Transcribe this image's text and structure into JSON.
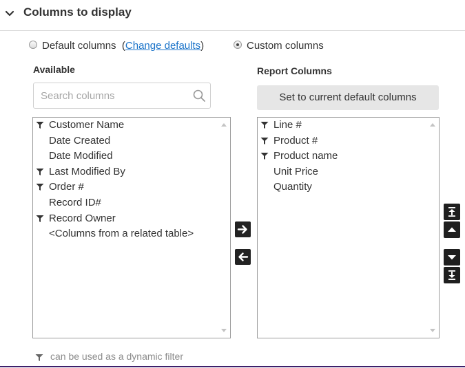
{
  "section": {
    "title": "Columns to display"
  },
  "options": {
    "default_label": "Default columns",
    "paren_open": "(",
    "change_defaults_link": "Change defaults",
    "paren_close": ")",
    "custom_label": "Custom columns",
    "selected": "custom"
  },
  "available": {
    "title": "Available",
    "search_placeholder": "Search columns",
    "items": [
      {
        "label": "Customer Name",
        "filterable": true
      },
      {
        "label": "Date Created",
        "filterable": false
      },
      {
        "label": "Date Modified",
        "filterable": false
      },
      {
        "label": "Last Modified By",
        "filterable": true
      },
      {
        "label": "Order #",
        "filterable": true
      },
      {
        "label": "Record ID#",
        "filterable": false
      },
      {
        "label": "Record Owner",
        "filterable": true
      },
      {
        "label": "<Columns from a related table>",
        "filterable": false
      }
    ]
  },
  "report": {
    "title": "Report Columns",
    "set_default_button": "Set to current default columns",
    "items": [
      {
        "label": "Line #",
        "filterable": true
      },
      {
        "label": "Product #",
        "filterable": true
      },
      {
        "label": "Product name",
        "filterable": true
      },
      {
        "label": "Unit Price",
        "filterable": false
      },
      {
        "label": "Quantity",
        "filterable": false
      }
    ]
  },
  "legend": {
    "text": "can be used as a dynamic filter"
  },
  "colors": {
    "link": "#1a73c9",
    "button_bg": "#e6e6e6",
    "dark_button": "#222222",
    "bottom_rule": "#3e1f6a"
  },
  "icons": {
    "section_toggle": "chevron-down-icon",
    "search": "search-icon",
    "filter": "filter-funnel-icon",
    "add": "arrow-right-icon",
    "remove": "arrow-left-icon",
    "move_top": "move-to-top-icon",
    "move_up": "move-up-icon",
    "move_down": "move-down-icon",
    "move_bottom": "move-to-bottom-icon"
  }
}
